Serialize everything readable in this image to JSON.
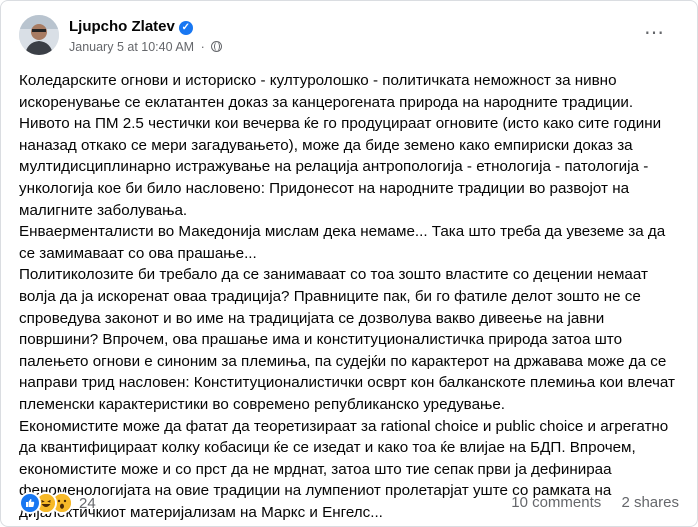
{
  "post": {
    "author": "Ljupcho Zlatev",
    "timestamp": "January 5 at 10:40 AM",
    "separator": "·",
    "paragraphs": [
      "Коледарските огнови и историско - културолошко - политичката неможност за нивно искоренување се еклатантен доказ за канцерогената природа на народните традиции. Нивото на ПМ 2.5 честички кои вечерва ќе го продуцираат огновите (исто како сите години наназад откако се мери загадувањето), може да биде земено како емпириски доказ за мултидисциплинарно истражување на релација антропологија - етнологија - патологија - ункологија кое би било насловено: Придонесот на народните традиции во развојот на малигните заболувања.",
      "Енваерменталисти во Македонија мислам дека немаме... Така што треба да увеземе за да се замимаваат со ова прашање...",
      "Политиколозите би требало да се занимаваат со тоа зошто властите со децении немаат волја да ја искоренат оваа традиција? Правниците пак, би го фатиле делот зошто не се спроведува законот и во име на традицијата се дозволува вакво дивеење на јавни површини? Впрочем, ова прашање има и конституционалистичка природа затоа што палењето огнови е синоним за племиња, па судејќи по карактерот на државава може да се направи трид насловен: Конституционалистички осврт кон балканскоте племиња кои влечат племенски карактеристики во современо републиканско уредување.",
      "Економистите може да фатат да теоретизираат за rational choice и public choice и агрегатно да квантифицираат колку кобасици ќе се изедат и како тоа ќе влијае на БДП. Впрочем, економистите може и со прст да не мрднат, затоа што тие сепак први ја дефинираа феноменологијата на овие традиции на лумпениот пролетарјат уште со рамката на дијалектичкиот материјализам на Маркс и Енгелс..."
    ]
  },
  "reactions": {
    "icons": [
      "like-icon",
      "haha-icon",
      "wow-icon"
    ],
    "count": "24"
  },
  "engagement": {
    "comments": "10 comments",
    "shares": "2 shares"
  },
  "colors": {
    "accent": "#1877f2",
    "secondary_text": "#65676b",
    "reaction_yellow": "#f7b928"
  }
}
